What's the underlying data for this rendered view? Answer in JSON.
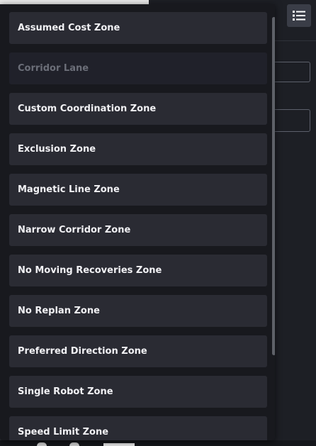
{
  "toolbar": {
    "list_view_icon": "list-icon"
  },
  "zone_menu": {
    "options": [
      {
        "label": "Assumed Cost Zone",
        "disabled": false
      },
      {
        "label": "Corridor Lane",
        "disabled": true
      },
      {
        "label": "Custom Coordination Zone",
        "disabled": false
      },
      {
        "label": "Exclusion Zone",
        "disabled": false
      },
      {
        "label": "Magnetic Line Zone",
        "disabled": false
      },
      {
        "label": "Narrow Corridor Zone",
        "disabled": false
      },
      {
        "label": "No Moving Recoveries Zone",
        "disabled": false
      },
      {
        "label": "No Replan Zone",
        "disabled": false
      },
      {
        "label": "Preferred Direction Zone",
        "disabled": false
      },
      {
        "label": "Single Robot Zone",
        "disabled": false
      },
      {
        "label": "Speed Limit Zone",
        "disabled": false
      }
    ]
  },
  "colors": {
    "option_bg": "#2a2b33",
    "option_disabled_bg": "#20212a",
    "text": "#f1f1f4",
    "text_disabled": "#6b6e78",
    "menu_bg": "#18191e",
    "button_bg": "#3a3d47"
  }
}
